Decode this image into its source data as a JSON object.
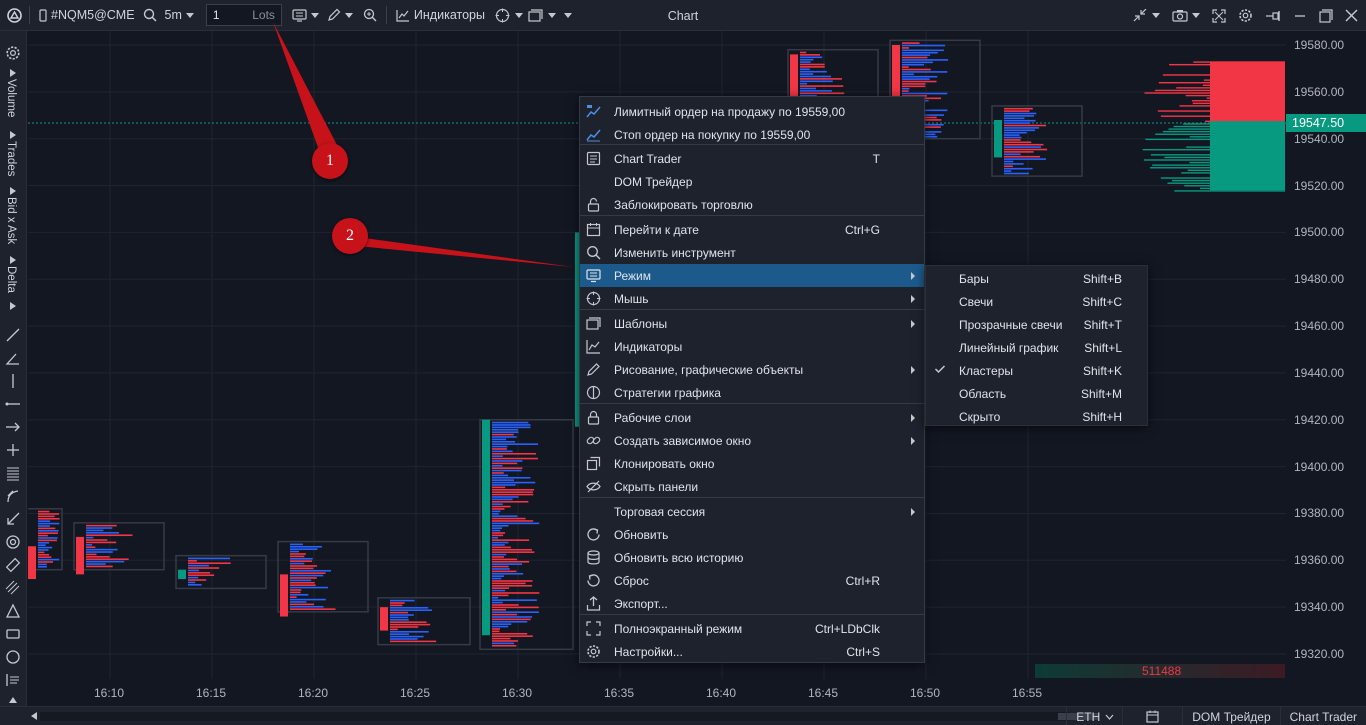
{
  "toolbar": {
    "symbol": "#NQM5@CME",
    "timeframe": "5m",
    "quantity": "1",
    "quantity_unit": "Lots",
    "indicators_label": "Индикаторы",
    "title": "Chart"
  },
  "sidebar": {
    "panels": [
      "Volume",
      "Trades",
      "Bid x Ask",
      "Delta"
    ]
  },
  "chart": {
    "price_axis": [
      "19580.00",
      "19560.00",
      "19540.00",
      "19520.00",
      "19500.00",
      "19480.00",
      "19460.00",
      "19440.00",
      "19420.00",
      "19400.00",
      "19380.00",
      "19360.00",
      "19340.00",
      "19320.00"
    ],
    "current_price": "19547.50",
    "time_axis": [
      "16:10",
      "16:15",
      "16:20",
      "16:25",
      "16:30",
      "16:35",
      "16:40",
      "16:45",
      "16:50",
      "16:55"
    ],
    "volume_value": "511488",
    "colors": {
      "bull": "#089981",
      "bear": "#f23645",
      "bid": "#2962ff",
      "ask": "#f23645",
      "bg": "#131722"
    }
  },
  "context_menu": {
    "items": [
      {
        "label": "Лимитный ордер на продажу по 19559,00",
        "shortcut": "",
        "icon": "limit-order-icon"
      },
      {
        "label": "Стоп ордер на покупку по 19559,00",
        "shortcut": "",
        "icon": "stop-order-icon"
      },
      {
        "label": "Chart Trader",
        "shortcut": "T",
        "icon": "chart-trader-icon"
      },
      {
        "label": "DOM Трейдер",
        "shortcut": "",
        "icon": ""
      },
      {
        "label": "Заблокировать торговлю",
        "shortcut": "",
        "icon": "lock-icon"
      },
      {
        "label": "Перейти к дате",
        "shortcut": "Ctrl+G",
        "icon": "calendar-icon"
      },
      {
        "label": "Изменить инструмент",
        "shortcut": "",
        "icon": "search-icon"
      },
      {
        "label": "Режим",
        "shortcut": "",
        "icon": "mode-icon",
        "submenu": true
      },
      {
        "label": "Мышь",
        "shortcut": "",
        "icon": "crosshair-icon",
        "submenu": true
      },
      {
        "label": "Шаблоны",
        "shortcut": "",
        "icon": "templates-icon",
        "submenu": true
      },
      {
        "label": "Индикаторы",
        "shortcut": "",
        "icon": "indicators-icon"
      },
      {
        "label": "Рисование, графические объекты",
        "shortcut": "",
        "icon": "pencil-icon",
        "submenu": true
      },
      {
        "label": "Стратегии графика",
        "shortcut": "",
        "icon": "strategy-icon"
      },
      {
        "label": "Рабочие слои",
        "shortcut": "",
        "icon": "layers-icon",
        "submenu": true
      },
      {
        "label": "Создать зависимое окно",
        "shortcut": "",
        "icon": "link-icon",
        "submenu": true
      },
      {
        "label": "Клонировать окно",
        "shortcut": "",
        "icon": "clone-icon"
      },
      {
        "label": "Скрыть панели",
        "shortcut": "",
        "icon": "hide-icon"
      },
      {
        "label": "Торговая сессия",
        "shortcut": "",
        "icon": "",
        "submenu": true
      },
      {
        "label": "Обновить",
        "shortcut": "",
        "icon": "refresh-icon"
      },
      {
        "label": "Обновить всю историю",
        "shortcut": "",
        "icon": "database-icon"
      },
      {
        "label": "Сброс",
        "shortcut": "Ctrl+R",
        "icon": "reset-icon"
      },
      {
        "label": "Экспорт...",
        "shortcut": "",
        "icon": "export-icon"
      },
      {
        "label": "Полноэкранный режим",
        "shortcut": "Ctrl+LDbClk",
        "icon": "fullscreen-icon"
      },
      {
        "label": "Настройки...",
        "shortcut": "Ctrl+S",
        "icon": "gear-icon"
      }
    ]
  },
  "mode_submenu": {
    "items": [
      {
        "label": "Бары",
        "shortcut": "Shift+B",
        "checked": false
      },
      {
        "label": "Свечи",
        "shortcut": "Shift+C",
        "checked": false
      },
      {
        "label": "Прозрачные свечи",
        "shortcut": "Shift+T",
        "checked": false
      },
      {
        "label": "Линейный график",
        "shortcut": "Shift+L",
        "checked": false
      },
      {
        "label": "Кластеры",
        "shortcut": "Shift+K",
        "checked": true
      },
      {
        "label": "Область",
        "shortcut": "Shift+M",
        "checked": false
      },
      {
        "label": "Скрыто",
        "shortcut": "Shift+H",
        "checked": false
      }
    ]
  },
  "callouts": [
    "1",
    "2"
  ],
  "bottombar": {
    "session": "ETH",
    "dom_trader": "DOM Трейдер",
    "chart_trader": "Chart Trader"
  }
}
